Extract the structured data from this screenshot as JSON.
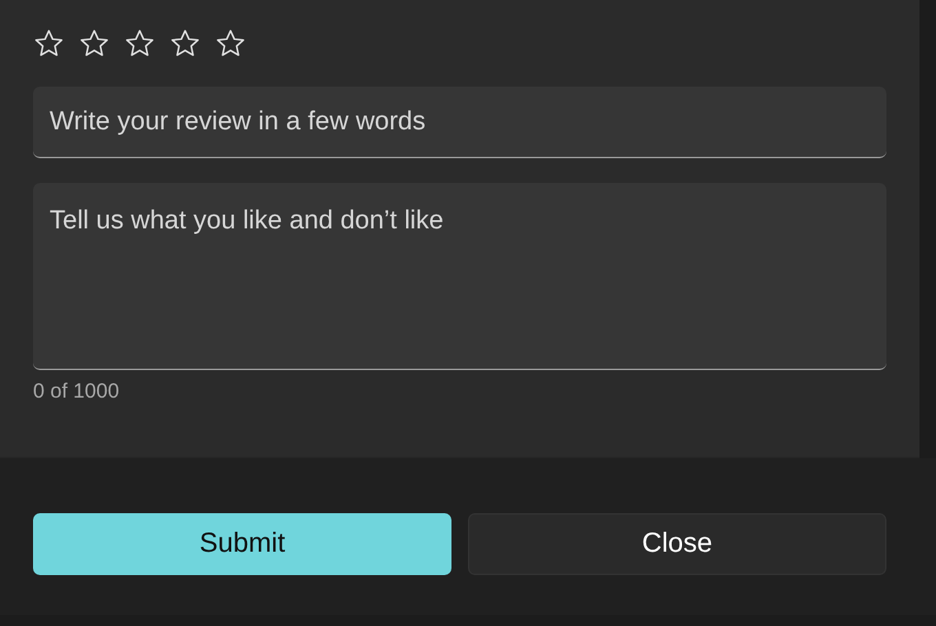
{
  "rating": {
    "stars": 0
  },
  "title_field": {
    "placeholder": "Write your review in a few words"
  },
  "body_field": {
    "placeholder": "Tell us what you like and don’t like"
  },
  "counter": "0 of 1000",
  "buttons": [
    {
      "label": "Submit",
      "kind": "primary"
    },
    {
      "label": "Close",
      "kind": "secondary"
    }
  ]
}
